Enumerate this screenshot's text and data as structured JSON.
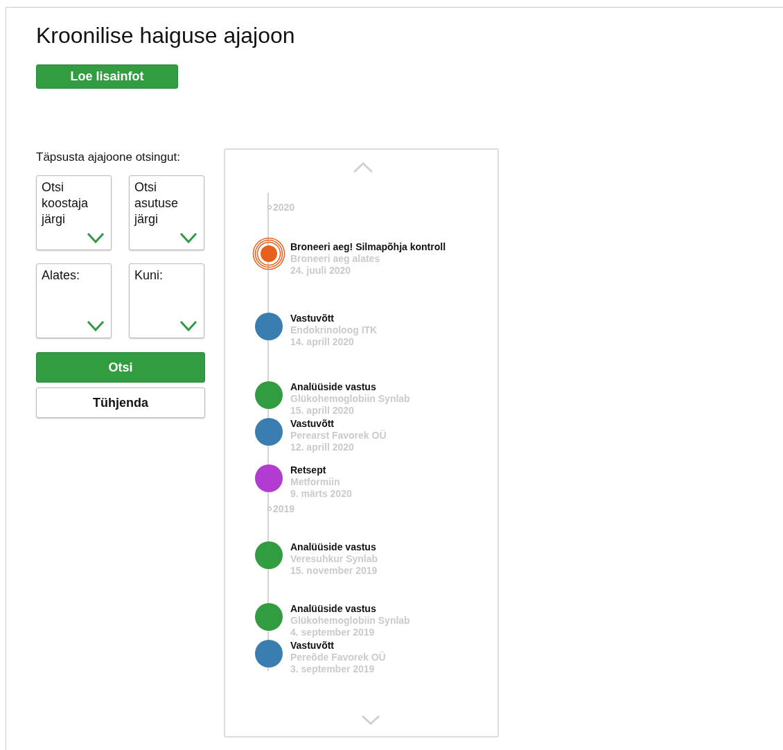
{
  "title": "Kroonilise haiguse ajajoon",
  "info_button": "Loe lisainfot",
  "filter": {
    "label": "Täpsusta ajajoone otsingut:",
    "dropdowns": [
      {
        "label": "Otsi koostaja järgi"
      },
      {
        "label": "Otsi asutuse järgi"
      },
      {
        "label": "Alates:"
      },
      {
        "label": "Kuni:"
      }
    ],
    "search_button": "Otsi",
    "clear_button": "Tühjenda"
  },
  "timeline": {
    "items": [
      {
        "kind": "year",
        "label": "2020"
      },
      {
        "kind": "reminder",
        "color": "#e8601c",
        "title": "Broneeri aeg! Silmapõhja kontroll",
        "subtitle": "Broneeri aeg alates",
        "date": "24. juuli 2020"
      },
      {
        "kind": "event",
        "color": "#3a7db0",
        "title": "Vastuvõtt",
        "subtitle": "Endokrinoloog ITK",
        "date": "14. aprill 2020"
      },
      {
        "kind": "event",
        "color": "#329c41",
        "title": "Analüüside vastus",
        "subtitle": "Glükohemoglobiin Synlab",
        "date": "15. aprill 2020"
      },
      {
        "kind": "event",
        "color": "#3a7db0",
        "title": "Vastuvõtt",
        "subtitle": "Perearst Favorek OÜ",
        "date": "12. aprill 2020"
      },
      {
        "kind": "event",
        "color": "#b23bd1",
        "title": "Retsept",
        "subtitle": "Metformiin",
        "date": "9. märts 2020"
      },
      {
        "kind": "year",
        "label": "2019"
      },
      {
        "kind": "event",
        "color": "#329c41",
        "title": "Analüüside vastus",
        "subtitle": "Veresuhkur Synlab",
        "date": "15. november 2019"
      },
      {
        "kind": "event",
        "color": "#329c41",
        "title": "Analüüside vastus",
        "subtitle": "Glükohemoglobiin Synlab",
        "date": "4. september 2019"
      },
      {
        "kind": "event",
        "color": "#3a7db0",
        "title": "Vastuvõtt",
        "subtitle": "Pereõde Favorek OÜ",
        "date": "3. september 2019"
      }
    ]
  }
}
